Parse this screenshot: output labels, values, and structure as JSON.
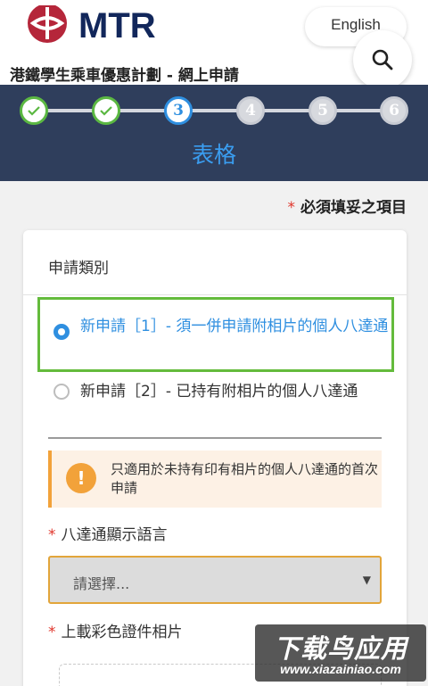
{
  "header": {
    "logo_text": "MTR",
    "language_button": "English",
    "page_heading": "港鐵學生乘車優惠計劃 - 網上申請"
  },
  "stepper": {
    "steps": [
      {
        "label": "",
        "state": "done"
      },
      {
        "label": "",
        "state": "done"
      },
      {
        "label": "3",
        "state": "current"
      },
      {
        "label": "4",
        "state": "todo"
      },
      {
        "label": "5",
        "state": "todo"
      },
      {
        "label": "6",
        "state": "todo"
      }
    ],
    "current_title": "表格"
  },
  "required_note": {
    "star": "*",
    "text": "必須填妥之項目"
  },
  "form": {
    "section_title": "申請類別",
    "options": [
      {
        "label": "新申請［1］- 須一併申請附相片的個人八達通",
        "checked": true
      },
      {
        "label": "新申請［2］- 已持有附相片的個人八達通",
        "checked": false
      }
    ],
    "notice": {
      "icon": "!",
      "text": "只適用於未持有印有相片的個人八達通的首次申請"
    },
    "language_field": {
      "star": "*",
      "label": "八達通顯示語言",
      "placeholder": "請選擇..."
    },
    "photo_field": {
      "star": "*",
      "label": "上載彩色證件相片"
    }
  },
  "watermark": {
    "main": "下载鸟应用",
    "sub": "www.xiazainiao.com"
  },
  "colors": {
    "nav_band": "#2f3e5c",
    "accent_blue": "#2f8fe0",
    "done_green": "#5bb842",
    "highlight_green": "#64bb3c",
    "notice_orange": "#f2a23a",
    "required_red": "#e0352b",
    "mtr_red": "#b5263a"
  }
}
